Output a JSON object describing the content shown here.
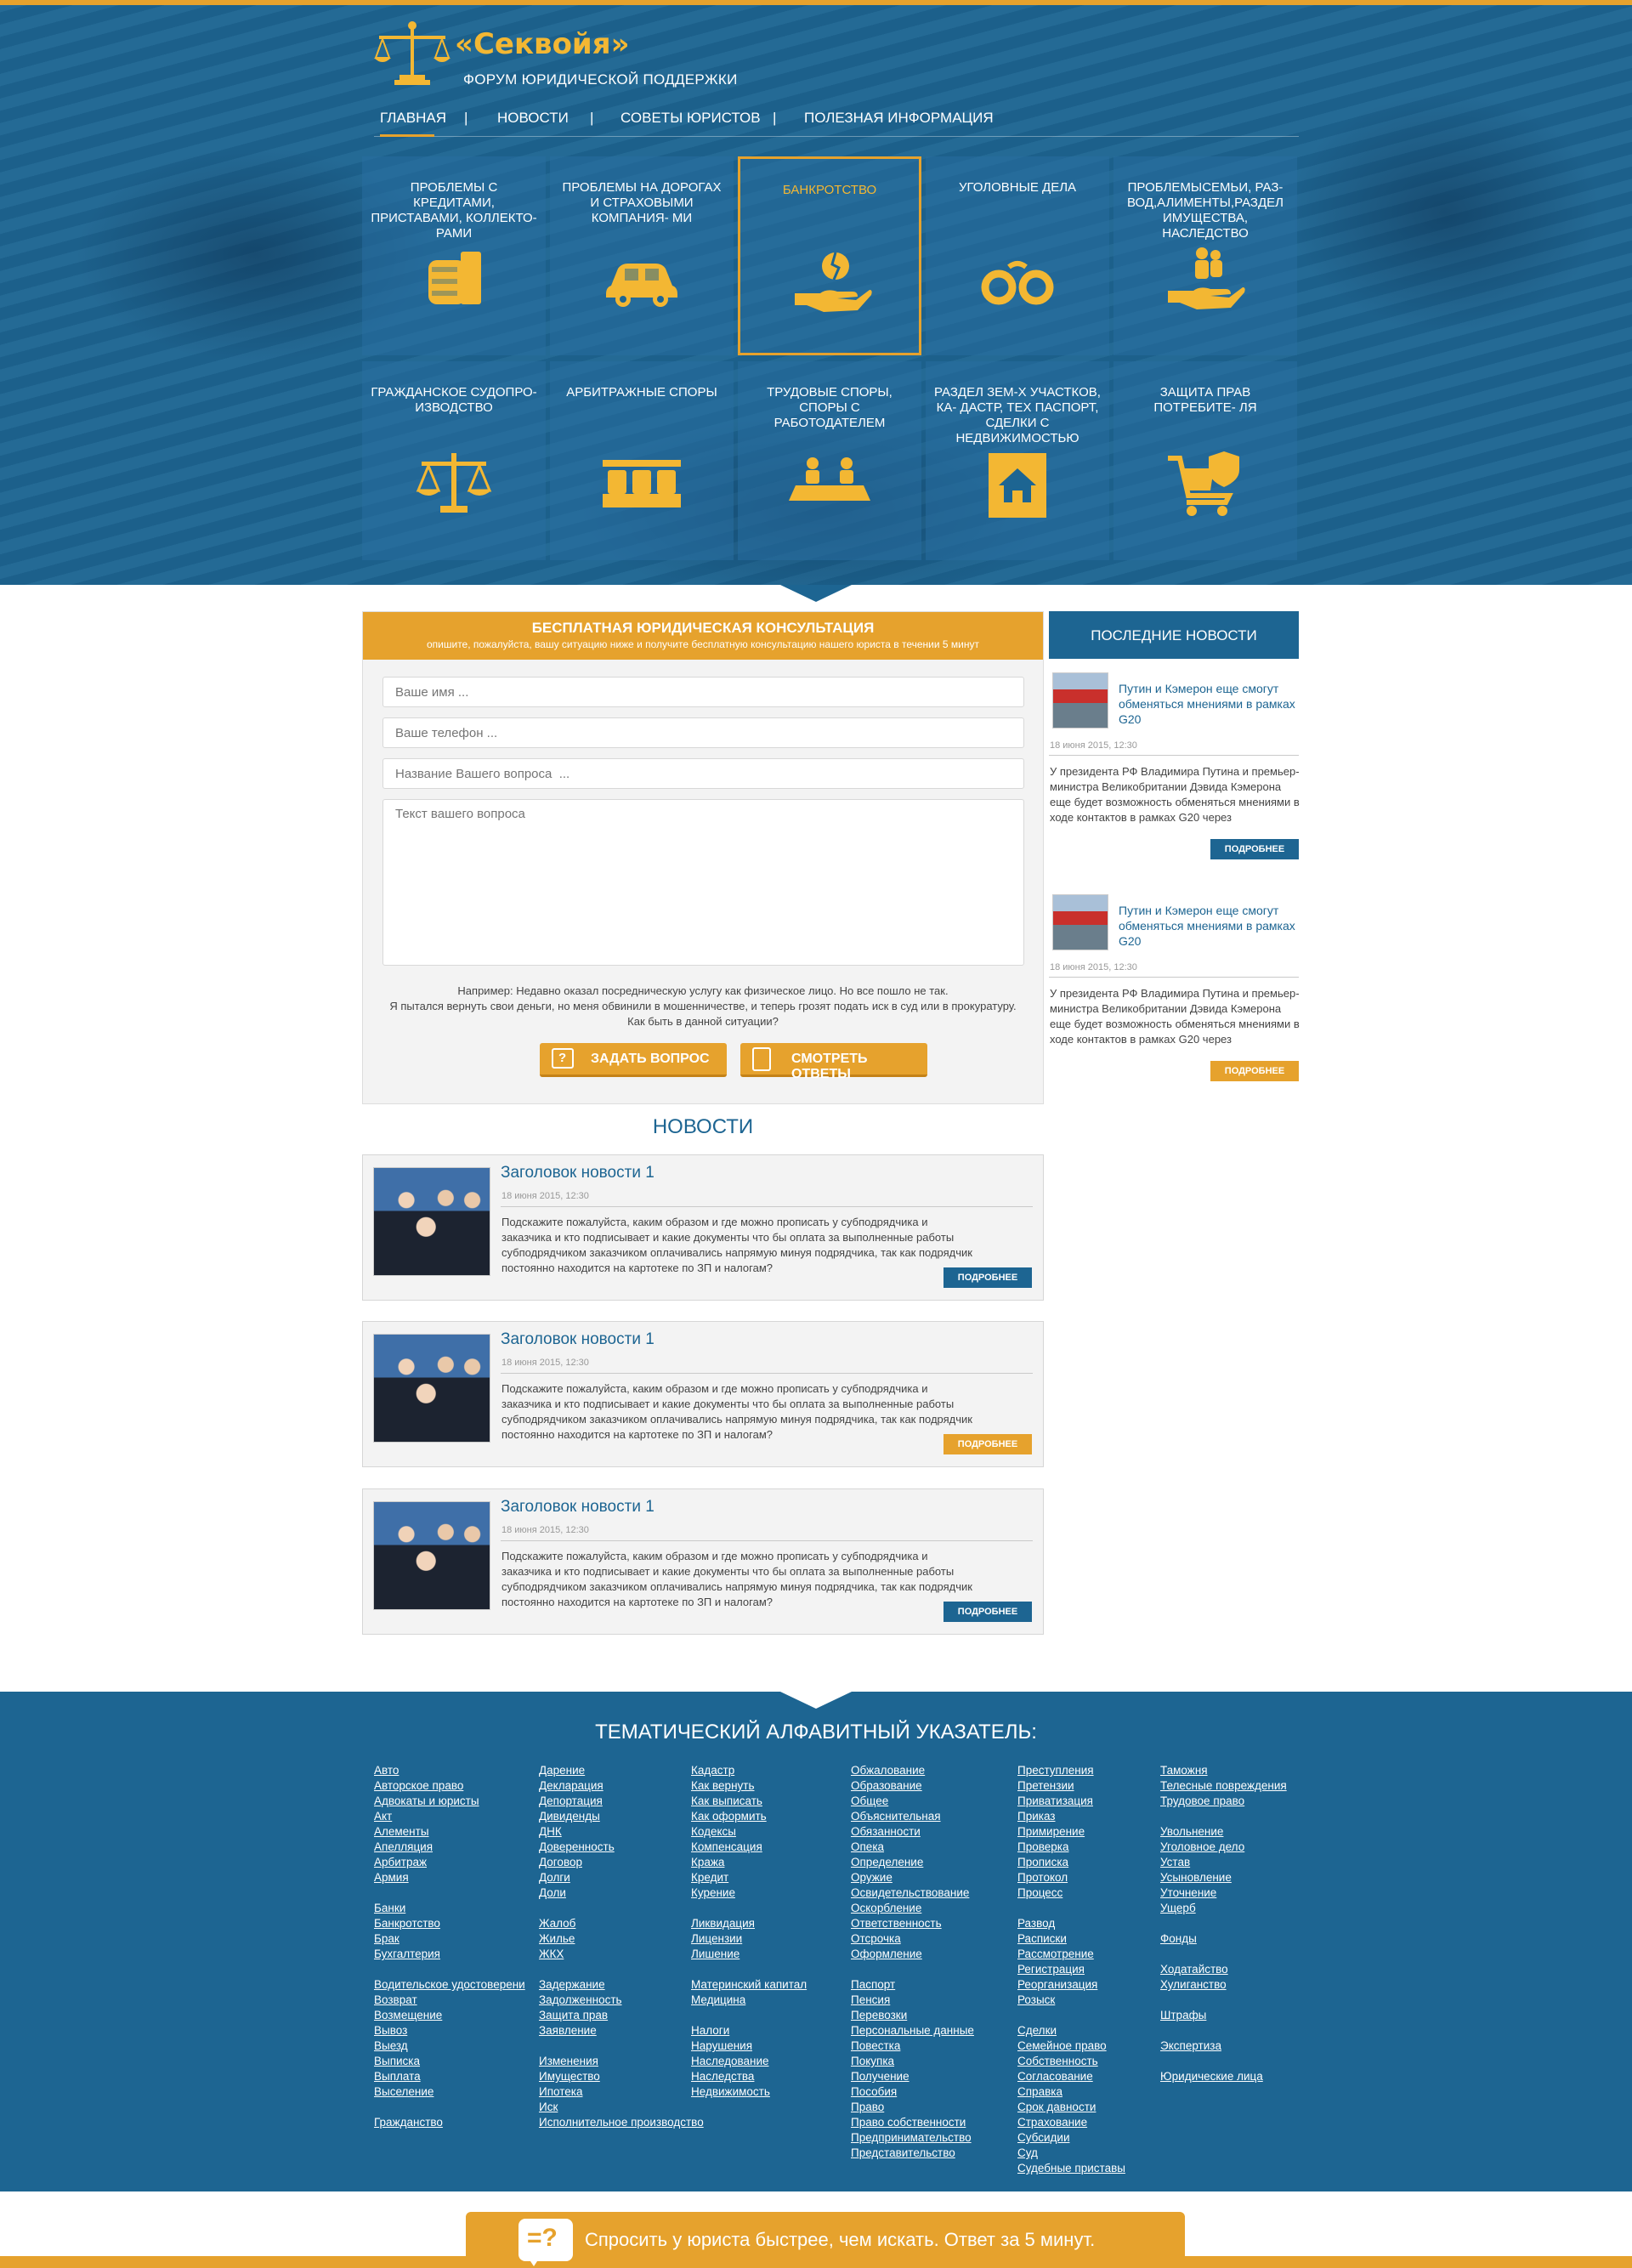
{
  "brand": {
    "name": "«Секвойя»",
    "tagline": "ФОРУМ ЮРИДИЧЕСКОЙ ПОДДЕРЖКИ"
  },
  "nav": [
    "ГЛАВНАЯ",
    "НОВОСТИ",
    "СОВЕТЫ ЮРИСТОВ",
    "ПОЛЕЗНАЯ ИНФОРМАЦИЯ"
  ],
  "nav_sep": "|",
  "tiles": [
    {
      "label": "ПРОБЛЕМЫ С КРЕДИТАМИ, ПРИСТАВАМИ, КОЛЛЕКТО- РАМИ",
      "icon": "fist-money-icon"
    },
    {
      "label": "ПРОБЛЕМЫ НА ДОРОГАХ И СТРАХОВЫМИ КОМПАНИЯ- МИ",
      "icon": "car-icon"
    },
    {
      "label": "БАНКРОТСТВО",
      "icon": "broken-coin-hand-icon",
      "selected": true
    },
    {
      "label": "УГОЛОВНЫЕ ДЕЛА",
      "icon": "handcuffs-icon"
    },
    {
      "label": "ПРОБЛЕМЫСЕМЬИ, РАЗ- ВОД,АЛИМЕНТЫ,РАЗДЕЛ ИМУЩЕСТВА, НАСЛЕДСТВО",
      "icon": "family-hand-icon"
    },
    {
      "label": "ГРАЖДАНСКОЕ СУДОПРО- ИЗВОДСТВО",
      "icon": "scales-icon"
    },
    {
      "label": "АРБИТРАЖНЫЕ СПОРЫ",
      "icon": "court-bench-icon"
    },
    {
      "label": "ТРУДОВЫЕ СПОРЫ, СПОРЫ С РАБОТОДАТЕЛЕМ",
      "icon": "meeting-table-icon"
    },
    {
      "label": "РАЗДЕЛ ЗЕМ-Х УЧАСТКОВ, КА- ДАСТР, ТЕХ ПАСПОРТ, СДЕЛКИ С НЕДВИЖИМОСТЬЮ",
      "icon": "house-icon"
    },
    {
      "label": "ЗАЩИТА ПРАВ ПОТРЕБИТЕ- ЛЯ",
      "icon": "shopping-cart-shield-icon"
    }
  ],
  "consult": {
    "title": "БЕСПЛАТНАЯ ЮРИДИЧЕСКАЯ КОНСУЛЬТАЦИЯ",
    "subtitle": "опишите, пожалуйста, вашу ситуацию ниже и получите бесплатную консультацию нашего юриста в течении 5 минут",
    "name_ph": "Ваше имя ...",
    "phone_ph": "Ваше телефон ...",
    "question_ph": "Название Вашего вопроса  ...",
    "text_ph": "Текст вашего вопроса",
    "example_1": "Например: Недавно оказал посредническую услугу как физическое лицо. Но все пошло не так.",
    "example_2": "Я пытался вернуть свои деньги, но меня обвинили в мошенничестве, и теперь грозят подать иск в суд или в прокуратуру.",
    "example_3": "Как быть в данной ситуации?",
    "ask_btn": "ЗАДАТЬ ВОПРОС",
    "answers_btn": "СМОТРЕТЬ ОТВЕТЫ"
  },
  "side": {
    "title": "ПОСЛЕДНИЕ НОВОСТИ",
    "items": [
      {
        "title": "Путин и Кэмерон еще смогут обменяться мнениями в рамках G20",
        "date": "18 июня 2015, 12:30",
        "text": "У президента РФ Владимира Путина и премьер-министра Великобритании Дэвида Кэмерона еще будет возможность обменяться мнениями в ходе контактов в рамках G20 через",
        "btn": "ПОДРОБНЕЕ"
      },
      {
        "title": "Путин и Кэмерон еще смогут обменяться мнениями в рамках G20",
        "date": "18 июня 2015, 12:30",
        "text": "У президента РФ Владимира Путина и премьер-министра Великобритании Дэвида Кэмерона еще будет возможность обменяться мнениями в ходе контактов в рамках G20 через",
        "btn": "ПОДРОБНЕЕ"
      }
    ]
  },
  "news": {
    "title": "НОВОСТИ",
    "items": [
      {
        "title": "Заголовок новости 1",
        "date": "18 июня 2015, 12:30",
        "text": "Подскажите пожалуйста, каким образом и где можно прописать у субподрядчика и заказчика и кто подписывает и какие документы что бы оплата за выполненные работы субподрядчиком заказчиком оплачивались напрямую минуя подрядчика, так как подрядчик постоянно находится на картотеке по ЗП и налогам?",
        "btn": "ПОДРОБНЕЕ"
      },
      {
        "title": "Заголовок новости 1",
        "date": "18 июня 2015, 12:30",
        "text": "Подскажите пожалуйста, каким образом и где можно прописать у субподрядчика и заказчика и кто подписывает и какие документы что бы оплата за выполненные работы субподрядчиком заказчиком оплачивались напрямую минуя подрядчика, так как подрядчик постоянно находится на картотеке по ЗП и налогам?",
        "btn": "ПОДРОБНЕЕ"
      },
      {
        "title": "Заголовок новости 1",
        "date": "18 июня 2015, 12:30",
        "text": "Подскажите пожалуйста, каким образом и где можно прописать у субподрядчика и заказчика и кто подписывает и какие документы что бы оплата за выполненные работы субподрядчиком заказчиком оплачивались напрямую минуя подрядчика, так как подрядчик постоянно находится на картотеке по ЗП и налогам?",
        "btn": "ПОДРОБНЕЕ"
      }
    ]
  },
  "index": {
    "title": "ТЕМАТИЧЕСКИЙ АЛФАВИТНЫЙ УКАЗАТЕЛЬ:",
    "columns": [
      [
        [
          "Авто",
          "Авторское право",
          "Адвокаты и юристы",
          "Акт",
          "Алементы",
          "Апелляция",
          "Арбитраж",
          "Армия"
        ],
        [
          "Банки",
          "Банкротство",
          "Брак",
          "Бухгалтерия"
        ],
        [
          "Водительское удостоверени",
          "Возврат",
          "Возмещение",
          "Вывоз",
          "Выезд",
          "Выписка",
          "Выплата",
          "Выселение"
        ],
        [
          "Гражданство"
        ]
      ],
      [
        [
          "Дарение",
          "Декларация",
          "Депортация",
          "Дивиденды",
          "ДНК",
          "Доверенность",
          "Договор",
          "Долги ",
          "Доли"
        ],
        [
          "Жалоб",
          "Жилье",
          "ЖКХ"
        ],
        [
          "Задержание",
          "Задолженность",
          "Защита прав",
          "Заявление"
        ],
        [
          "Изменения",
          "Имущество",
          "Ипотека",
          "Иск",
          "Исполнительное производство"
        ]
      ],
      [
        [
          "Кадастр",
          "Как вернуть",
          "Как выписать",
          "Как оформить",
          "Кодексы",
          "Компенсация",
          "Кража",
          "Кредит",
          "Курение"
        ],
        [
          "Ликвидация",
          "Лицензии",
          "Лишение"
        ],
        [
          "Материнский капитал",
          "Медицина"
        ],
        [
          "Налоги",
          "Нарушения",
          "Наследование",
          "Наследства",
          "Недвижимость"
        ]
      ],
      [
        [
          "Обжалование",
          "Образование",
          "Общее",
          "Объяснительная",
          "Обязанности",
          "Опека",
          "Определение",
          "Оружие",
          "Освидетельствование",
          "Оскорбление",
          "Ответственность",
          "Отсрочка",
          "Оформление"
        ],
        [
          "Паспорт",
          "Пенсия",
          "Перевозки",
          "Персональные данные ",
          "Повестка",
          "Покупка",
          "Получение",
          "Пособия",
          "Право",
          "Право собственности",
          "Предпринимательство",
          "Представительство"
        ]
      ],
      [
        [
          "Преступления",
          "Претензии",
          "Приватизация",
          "Приказ",
          "Примирение",
          "Проверка",
          "Прописка",
          "Протокол",
          "Процесс"
        ],
        [
          "Развод",
          "Расписки",
          "Рассмотрение",
          "Регистрация",
          "Реорганизация",
          "Розыск"
        ],
        [
          "Сделки",
          "Семейное право",
          "Собственность",
          "Согласование",
          "Справка",
          "Срок давности",
          "Страхование",
          "Субсидии",
          "Суд",
          "Судебные приставы"
        ]
      ],
      [
        [
          "Таможня",
          "Телесные повреждения",
          "Трудовое право"
        ],
        [
          "Увольнение",
          "Уголовное дело",
          "Устав",
          "Усыновление",
          "Уточнение",
          "Ущерб"
        ],
        [
          "Фонды"
        ],
        [
          "Ходатайство",
          "Хулиганство"
        ],
        [
          "Штрафы"
        ],
        [
          "Экспертиза"
        ],
        [
          "Юридические лица"
        ]
      ]
    ]
  },
  "cta": {
    "icon_text": "=?",
    "text": "Спросить у юриста быстрее, чем искать. Ответ за 5 минут."
  },
  "colors": {
    "blue": "#1d6592",
    "orange": "#e6a22d",
    "gold": "#f3b733"
  }
}
